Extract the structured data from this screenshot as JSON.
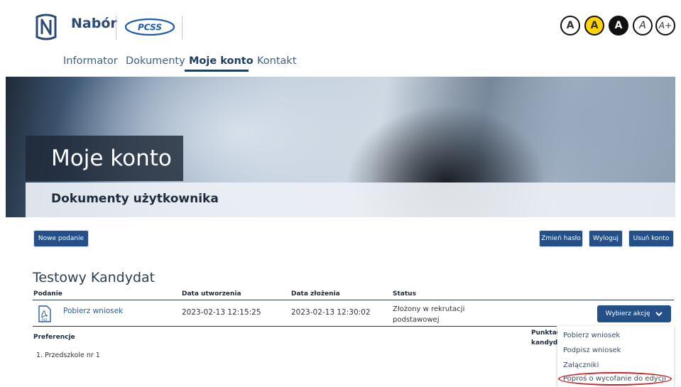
{
  "header": {
    "brand": "Nabór",
    "partner_logo_text": "PCSS",
    "accessibility": [
      "A",
      "A",
      "A",
      "A",
      "A+"
    ]
  },
  "nav": {
    "items": [
      "Informator",
      "Dokumenty",
      "Moje konto",
      "Kontakt"
    ],
    "active": "Moje konto"
  },
  "hero": {
    "title": "Moje konto",
    "subtitle": "Dokumenty użytkownika"
  },
  "actions": {
    "new_application": "Nowe podanie",
    "change_password": "Zmień hasło",
    "logout": "Wyloguj",
    "delete_account": "Usuń konto"
  },
  "candidate": {
    "name": "Testowy Kandydat",
    "columns": [
      "Podanie",
      "Data utworzenia",
      "Data złożenia",
      "Status"
    ],
    "row": {
      "document_link": "Pobierz wniosek",
      "created": "2023-02-13 12:15:25",
      "submitted": "2023-02-13 12:30:02",
      "status": "Złożony w rekrutacji podstawowej"
    },
    "action_button": "Wybierz akcję",
    "preferences_label": "Preferencje",
    "points_label": "Punktac kandyda",
    "preferences": [
      "1. Przedszkole nr 1"
    ]
  },
  "action_menu": {
    "items": [
      "Pobierz wniosek",
      "Podpisz wniosek",
      "Załączniki",
      "Poproś o wycofanie do edycji"
    ],
    "highlighted": "Poproś o wycofanie do edycji"
  },
  "colors": {
    "primary": "#244f87",
    "highlight": "#d2232a",
    "accessibility_yellow": "#ffd400"
  }
}
